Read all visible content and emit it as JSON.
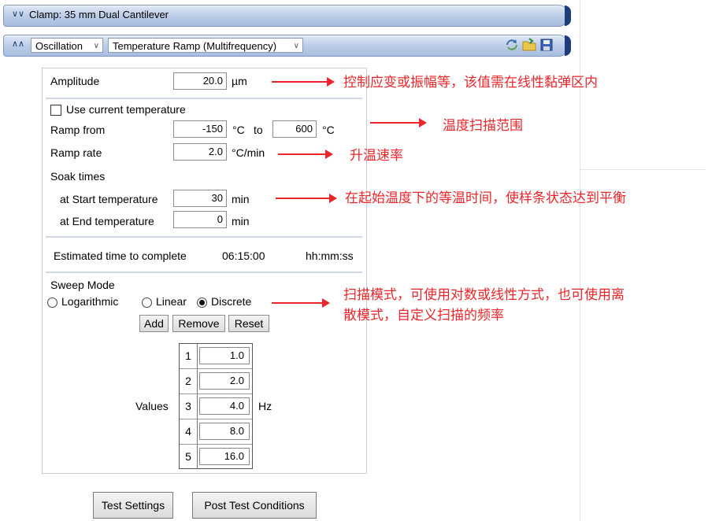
{
  "header": {
    "clamp_title": "Clamp: 35 mm Dual Cantilever",
    "mode_select": "Oscillation",
    "test_select": "Temperature Ramp (Multifrequency)"
  },
  "amplitude": {
    "label": "Amplitude",
    "value": "20.0",
    "unit": "µm"
  },
  "use_current_temp": {
    "label": "Use current temperature",
    "checked": false
  },
  "ramp_from": {
    "label": "Ramp from",
    "start": "-150",
    "start_unit": "°C",
    "to_label": "to",
    "end": "600",
    "end_unit": "°C"
  },
  "ramp_rate": {
    "label": "Ramp rate",
    "value": "2.0",
    "unit": "°C/min"
  },
  "soak": {
    "title": "Soak times",
    "start_label": "at Start temperature",
    "start_value": "30",
    "start_unit": "min",
    "end_label": "at End temperature",
    "end_value": "0",
    "end_unit": "min"
  },
  "estimate": {
    "label": "Estimated time to complete",
    "value": "06:15:00",
    "format": "hh:mm:ss"
  },
  "sweep": {
    "title": "Sweep Mode",
    "options": [
      "Logarithmic",
      "Linear",
      "Discrete"
    ],
    "selected": "Discrete",
    "add": "Add",
    "remove": "Remove",
    "reset": "Reset"
  },
  "values": {
    "label": "Values",
    "unit": "Hz",
    "rows": [
      {
        "index": "1",
        "value": "1.0"
      },
      {
        "index": "2",
        "value": "2.0"
      },
      {
        "index": "3",
        "value": "4.0"
      },
      {
        "index": "4",
        "value": "8.0"
      },
      {
        "index": "5",
        "value": "16.0"
      }
    ]
  },
  "buttons": {
    "test_settings": "Test Settings",
    "post_test": "Post Test Conditions"
  },
  "annotations": {
    "amplitude": "控制应变或振幅等，该值需在线性黏弹区内",
    "range": "温度扫描范围",
    "rate": "升温速率",
    "soak": "在起始温度下的等温时间，使样条状态达到平衡",
    "sweep_line1": "扫描模式，可使用对数或线性方式，也可使用离",
    "sweep_line2": "散模式，自定义扫描的频率"
  },
  "colors": {
    "annotation": "#e8262b",
    "bar_accent": "#1c3d7a"
  }
}
